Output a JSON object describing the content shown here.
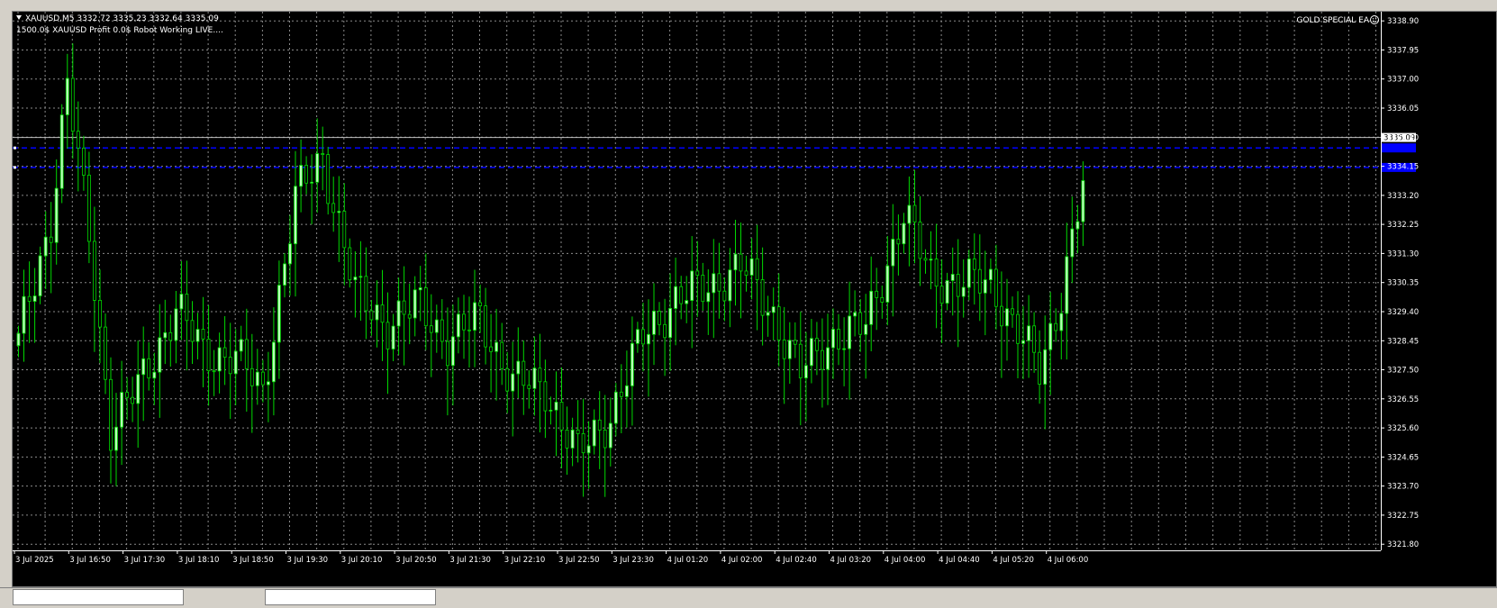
{
  "header": {
    "symbol_line": "XAUUSD,M5  3332.72 3335.23 3332.64 3335.09",
    "info_line": "1500.0$   XAUUSD   Profit  0.0$  Robot Working LIVE....",
    "ea_label": "GOLD SPECIAL EA",
    "ea_icon": "smiley-icon"
  },
  "colors": {
    "background": "#000000",
    "grid": "#8a8a8a",
    "bull_candle": "#b8ffb8",
    "bear_candle": "#000000",
    "wick": "#00d800",
    "text": "#ffffff",
    "level_line": "#0000ff",
    "bid_line": "#c0c0c0"
  },
  "chart_data": {
    "type": "candlestick",
    "symbol": "XAUUSD",
    "timeframe": "M5",
    "y_ticks": [
      "3338.90",
      "3337.95",
      "3337.00",
      "3336.05",
      "3335.10",
      "3334.15",
      "3333.20",
      "3332.25",
      "3331.30",
      "3330.35",
      "3329.40",
      "3328.45",
      "3327.50",
      "3326.55",
      "3325.60",
      "3324.65",
      "3323.70",
      "3322.75",
      "3321.80"
    ],
    "x_ticks": [
      "3 Jul 2025",
      "3 Jul 16:50",
      "3 Jul 17:30",
      "3 Jul 18:10",
      "3 Jul 18:50",
      "3 Jul 19:30",
      "3 Jul 20:10",
      "3 Jul 20:50",
      "3 Jul 21:30",
      "3 Jul 22:10",
      "3 Jul 22:50",
      "3 Jul 23:30",
      "4 Jul 01:20",
      "4 Jul 02:00",
      "4 Jul 02:40",
      "4 Jul 03:20",
      "4 Jul 04:00",
      "4 Jul 04:40",
      "4 Jul 05:20",
      "4 Jul 06:00"
    ],
    "ylim": [
      3321.6,
      3339.2
    ],
    "current_price": "3335.09",
    "horizontal_levels": [
      3334.75,
      3334.11
    ],
    "close_anchors": [
      [
        0,
        3328.4
      ],
      [
        6,
        3332.4
      ],
      [
        9,
        3336.8
      ],
      [
        13,
        3331.9
      ],
      [
        17,
        3325.6
      ],
      [
        22,
        3326.9
      ],
      [
        29,
        3329.5
      ],
      [
        34,
        3328.1
      ],
      [
        40,
        3327.9
      ],
      [
        45,
        3326.8
      ],
      [
        51,
        3333.1
      ],
      [
        56,
        3334.5
      ],
      [
        62,
        3330.0
      ],
      [
        68,
        3329.0
      ],
      [
        74,
        3329.6
      ],
      [
        79,
        3328.4
      ],
      [
        85,
        3329.2
      ],
      [
        91,
        3327.1
      ],
      [
        97,
        3326.9
      ],
      [
        103,
        3324.7
      ],
      [
        109,
        3326.0
      ],
      [
        115,
        3328.6
      ],
      [
        121,
        3329.8
      ],
      [
        127,
        3330.2
      ],
      [
        133,
        3330.9
      ],
      [
        139,
        3329.3
      ],
      [
        144,
        3327.4
      ],
      [
        150,
        3328.6
      ],
      [
        156,
        3328.9
      ],
      [
        163,
        3332.6
      ],
      [
        168,
        3330.6
      ],
      [
        173,
        3330.3
      ],
      [
        179,
        3330.4
      ],
      [
        183,
        3329.0
      ],
      [
        188,
        3327.5
      ],
      [
        192,
        3330.0
      ],
      [
        196,
        3333.5
      ]
    ]
  }
}
